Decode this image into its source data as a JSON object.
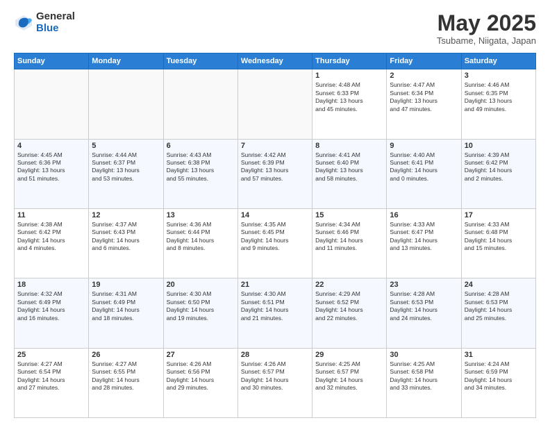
{
  "header": {
    "logo_general": "General",
    "logo_blue": "Blue",
    "month_title": "May 2025",
    "location": "Tsubame, Niigata, Japan"
  },
  "days_of_week": [
    "Sunday",
    "Monday",
    "Tuesday",
    "Wednesday",
    "Thursday",
    "Friday",
    "Saturday"
  ],
  "weeks": [
    [
      {
        "day": "",
        "empty": true
      },
      {
        "day": "",
        "empty": true
      },
      {
        "day": "",
        "empty": true
      },
      {
        "day": "",
        "empty": true
      },
      {
        "day": "1",
        "lines": [
          "Sunrise: 4:48 AM",
          "Sunset: 6:33 PM",
          "Daylight: 13 hours",
          "and 45 minutes."
        ]
      },
      {
        "day": "2",
        "lines": [
          "Sunrise: 4:47 AM",
          "Sunset: 6:34 PM",
          "Daylight: 13 hours",
          "and 47 minutes."
        ]
      },
      {
        "day": "3",
        "lines": [
          "Sunrise: 4:46 AM",
          "Sunset: 6:35 PM",
          "Daylight: 13 hours",
          "and 49 minutes."
        ]
      }
    ],
    [
      {
        "day": "4",
        "lines": [
          "Sunrise: 4:45 AM",
          "Sunset: 6:36 PM",
          "Daylight: 13 hours",
          "and 51 minutes."
        ]
      },
      {
        "day": "5",
        "lines": [
          "Sunrise: 4:44 AM",
          "Sunset: 6:37 PM",
          "Daylight: 13 hours",
          "and 53 minutes."
        ]
      },
      {
        "day": "6",
        "lines": [
          "Sunrise: 4:43 AM",
          "Sunset: 6:38 PM",
          "Daylight: 13 hours",
          "and 55 minutes."
        ]
      },
      {
        "day": "7",
        "lines": [
          "Sunrise: 4:42 AM",
          "Sunset: 6:39 PM",
          "Daylight: 13 hours",
          "and 57 minutes."
        ]
      },
      {
        "day": "8",
        "lines": [
          "Sunrise: 4:41 AM",
          "Sunset: 6:40 PM",
          "Daylight: 13 hours",
          "and 58 minutes."
        ]
      },
      {
        "day": "9",
        "lines": [
          "Sunrise: 4:40 AM",
          "Sunset: 6:41 PM",
          "Daylight: 14 hours",
          "and 0 minutes."
        ]
      },
      {
        "day": "10",
        "lines": [
          "Sunrise: 4:39 AM",
          "Sunset: 6:42 PM",
          "Daylight: 14 hours",
          "and 2 minutes."
        ]
      }
    ],
    [
      {
        "day": "11",
        "lines": [
          "Sunrise: 4:38 AM",
          "Sunset: 6:42 PM",
          "Daylight: 14 hours",
          "and 4 minutes."
        ]
      },
      {
        "day": "12",
        "lines": [
          "Sunrise: 4:37 AM",
          "Sunset: 6:43 PM",
          "Daylight: 14 hours",
          "and 6 minutes."
        ]
      },
      {
        "day": "13",
        "lines": [
          "Sunrise: 4:36 AM",
          "Sunset: 6:44 PM",
          "Daylight: 14 hours",
          "and 8 minutes."
        ]
      },
      {
        "day": "14",
        "lines": [
          "Sunrise: 4:35 AM",
          "Sunset: 6:45 PM",
          "Daylight: 14 hours",
          "and 9 minutes."
        ]
      },
      {
        "day": "15",
        "lines": [
          "Sunrise: 4:34 AM",
          "Sunset: 6:46 PM",
          "Daylight: 14 hours",
          "and 11 minutes."
        ]
      },
      {
        "day": "16",
        "lines": [
          "Sunrise: 4:33 AM",
          "Sunset: 6:47 PM",
          "Daylight: 14 hours",
          "and 13 minutes."
        ]
      },
      {
        "day": "17",
        "lines": [
          "Sunrise: 4:33 AM",
          "Sunset: 6:48 PM",
          "Daylight: 14 hours",
          "and 15 minutes."
        ]
      }
    ],
    [
      {
        "day": "18",
        "lines": [
          "Sunrise: 4:32 AM",
          "Sunset: 6:49 PM",
          "Daylight: 14 hours",
          "and 16 minutes."
        ]
      },
      {
        "day": "19",
        "lines": [
          "Sunrise: 4:31 AM",
          "Sunset: 6:49 PM",
          "Daylight: 14 hours",
          "and 18 minutes."
        ]
      },
      {
        "day": "20",
        "lines": [
          "Sunrise: 4:30 AM",
          "Sunset: 6:50 PM",
          "Daylight: 14 hours",
          "and 19 minutes."
        ]
      },
      {
        "day": "21",
        "lines": [
          "Sunrise: 4:30 AM",
          "Sunset: 6:51 PM",
          "Daylight: 14 hours",
          "and 21 minutes."
        ]
      },
      {
        "day": "22",
        "lines": [
          "Sunrise: 4:29 AM",
          "Sunset: 6:52 PM",
          "Daylight: 14 hours",
          "and 22 minutes."
        ]
      },
      {
        "day": "23",
        "lines": [
          "Sunrise: 4:28 AM",
          "Sunset: 6:53 PM",
          "Daylight: 14 hours",
          "and 24 minutes."
        ]
      },
      {
        "day": "24",
        "lines": [
          "Sunrise: 4:28 AM",
          "Sunset: 6:53 PM",
          "Daylight: 14 hours",
          "and 25 minutes."
        ]
      }
    ],
    [
      {
        "day": "25",
        "lines": [
          "Sunrise: 4:27 AM",
          "Sunset: 6:54 PM",
          "Daylight: 14 hours",
          "and 27 minutes."
        ]
      },
      {
        "day": "26",
        "lines": [
          "Sunrise: 4:27 AM",
          "Sunset: 6:55 PM",
          "Daylight: 14 hours",
          "and 28 minutes."
        ]
      },
      {
        "day": "27",
        "lines": [
          "Sunrise: 4:26 AM",
          "Sunset: 6:56 PM",
          "Daylight: 14 hours",
          "and 29 minutes."
        ]
      },
      {
        "day": "28",
        "lines": [
          "Sunrise: 4:26 AM",
          "Sunset: 6:57 PM",
          "Daylight: 14 hours",
          "and 30 minutes."
        ]
      },
      {
        "day": "29",
        "lines": [
          "Sunrise: 4:25 AM",
          "Sunset: 6:57 PM",
          "Daylight: 14 hours",
          "and 32 minutes."
        ]
      },
      {
        "day": "30",
        "lines": [
          "Sunrise: 4:25 AM",
          "Sunset: 6:58 PM",
          "Daylight: 14 hours",
          "and 33 minutes."
        ]
      },
      {
        "day": "31",
        "lines": [
          "Sunrise: 4:24 AM",
          "Sunset: 6:59 PM",
          "Daylight: 14 hours",
          "and 34 minutes."
        ]
      }
    ]
  ]
}
